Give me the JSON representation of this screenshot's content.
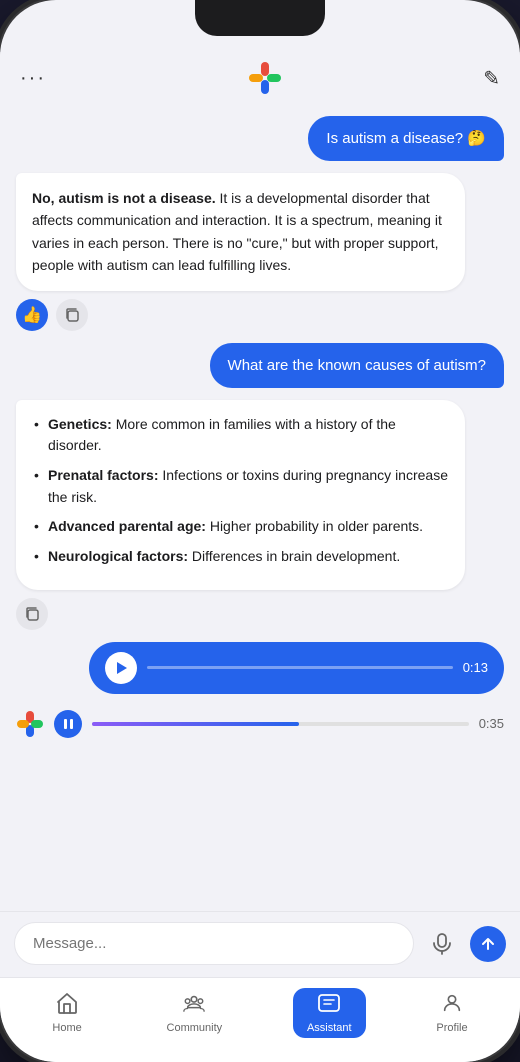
{
  "header": {
    "dots": "···",
    "edit_icon": "✎"
  },
  "messages": [
    {
      "type": "user",
      "text": "Is autism a disease? 🤔"
    },
    {
      "type": "bot",
      "html_content": "<b>No, autism is not a disease.</b> It is a developmental disorder that affects communication and interaction. It is a spectrum, meaning it varies in each person. There is no \"cure,\" but with proper support, people with autism can lead fulfilling lives."
    },
    {
      "type": "user",
      "text": "What are the known causes of autism?"
    },
    {
      "type": "bot",
      "list": [
        {
          "bold": "Genetics:",
          "text": " More common in families with a history of the disorder."
        },
        {
          "bold": "Prenatal factors:",
          "text": " Infections or toxins during pregnancy increase the risk."
        },
        {
          "bold": "Advanced parental age:",
          "text": " Higher probability in older parents."
        },
        {
          "bold": "Neurological factors:",
          "text": " Differences in brain development."
        }
      ]
    },
    {
      "type": "audio_user",
      "time": "0:13"
    },
    {
      "type": "audio_bot",
      "time": "0:35"
    }
  ],
  "input": {
    "placeholder": "Message..."
  },
  "nav": {
    "items": [
      {
        "id": "home",
        "label": "Home",
        "icon": "⌂",
        "active": false
      },
      {
        "id": "community",
        "label": "Community",
        "icon": "✦",
        "active": false
      },
      {
        "id": "assistant",
        "label": "Assistant",
        "icon": "⊟",
        "active": true
      },
      {
        "id": "profile",
        "label": "Profile",
        "icon": "◯",
        "active": false
      }
    ]
  },
  "reactions": {
    "like_icon": "👍",
    "copy_icon": "⧉"
  }
}
